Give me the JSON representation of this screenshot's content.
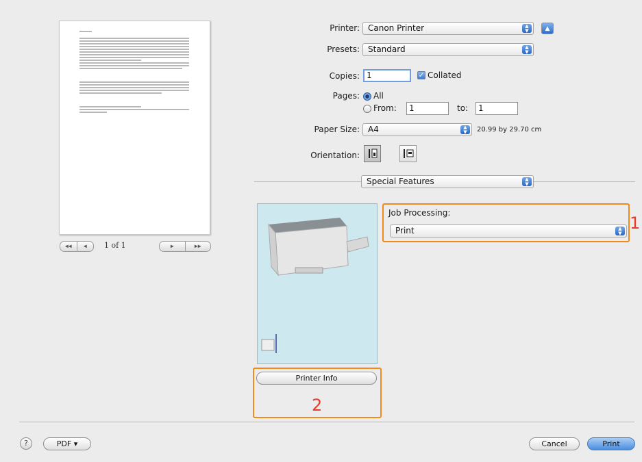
{
  "preview": {
    "page_label": "1 of 1",
    "nav_first": "◀◀",
    "nav_prev": "◀",
    "nav_next": "▶",
    "nav_last": "▶▶"
  },
  "printer": {
    "label": "Printer:",
    "value": "Canon Printer",
    "disclosure_icon": "▲"
  },
  "presets": {
    "label": "Presets:",
    "value": "Standard"
  },
  "copies": {
    "label": "Copies:",
    "value": "1",
    "collated_label": "Collated",
    "collated_checked": true
  },
  "pages": {
    "label": "Pages:",
    "all_label": "All",
    "from_label": "From:",
    "from_value": "1",
    "to_label": "to:",
    "to_value": "1",
    "selected": "All"
  },
  "paper_size": {
    "label": "Paper Size:",
    "value": "A4",
    "dimensions": "20.99 by 29.70 cm"
  },
  "orientation": {
    "label": "Orientation:",
    "selected": "portrait"
  },
  "section_menu": {
    "value": "Special Features"
  },
  "job_processing": {
    "label": "Job Processing:",
    "value": "Print"
  },
  "printer_info_button": "Printer Info",
  "annotations": {
    "one": "1",
    "two": "2"
  },
  "footer": {
    "help_icon": "?",
    "pdf_label": "PDF ▾",
    "cancel_label": "Cancel",
    "print_label": "Print"
  },
  "colors": {
    "highlight": "#f08a1b",
    "annotation": "#e83b25",
    "pane_bg": "#cde8ef"
  }
}
